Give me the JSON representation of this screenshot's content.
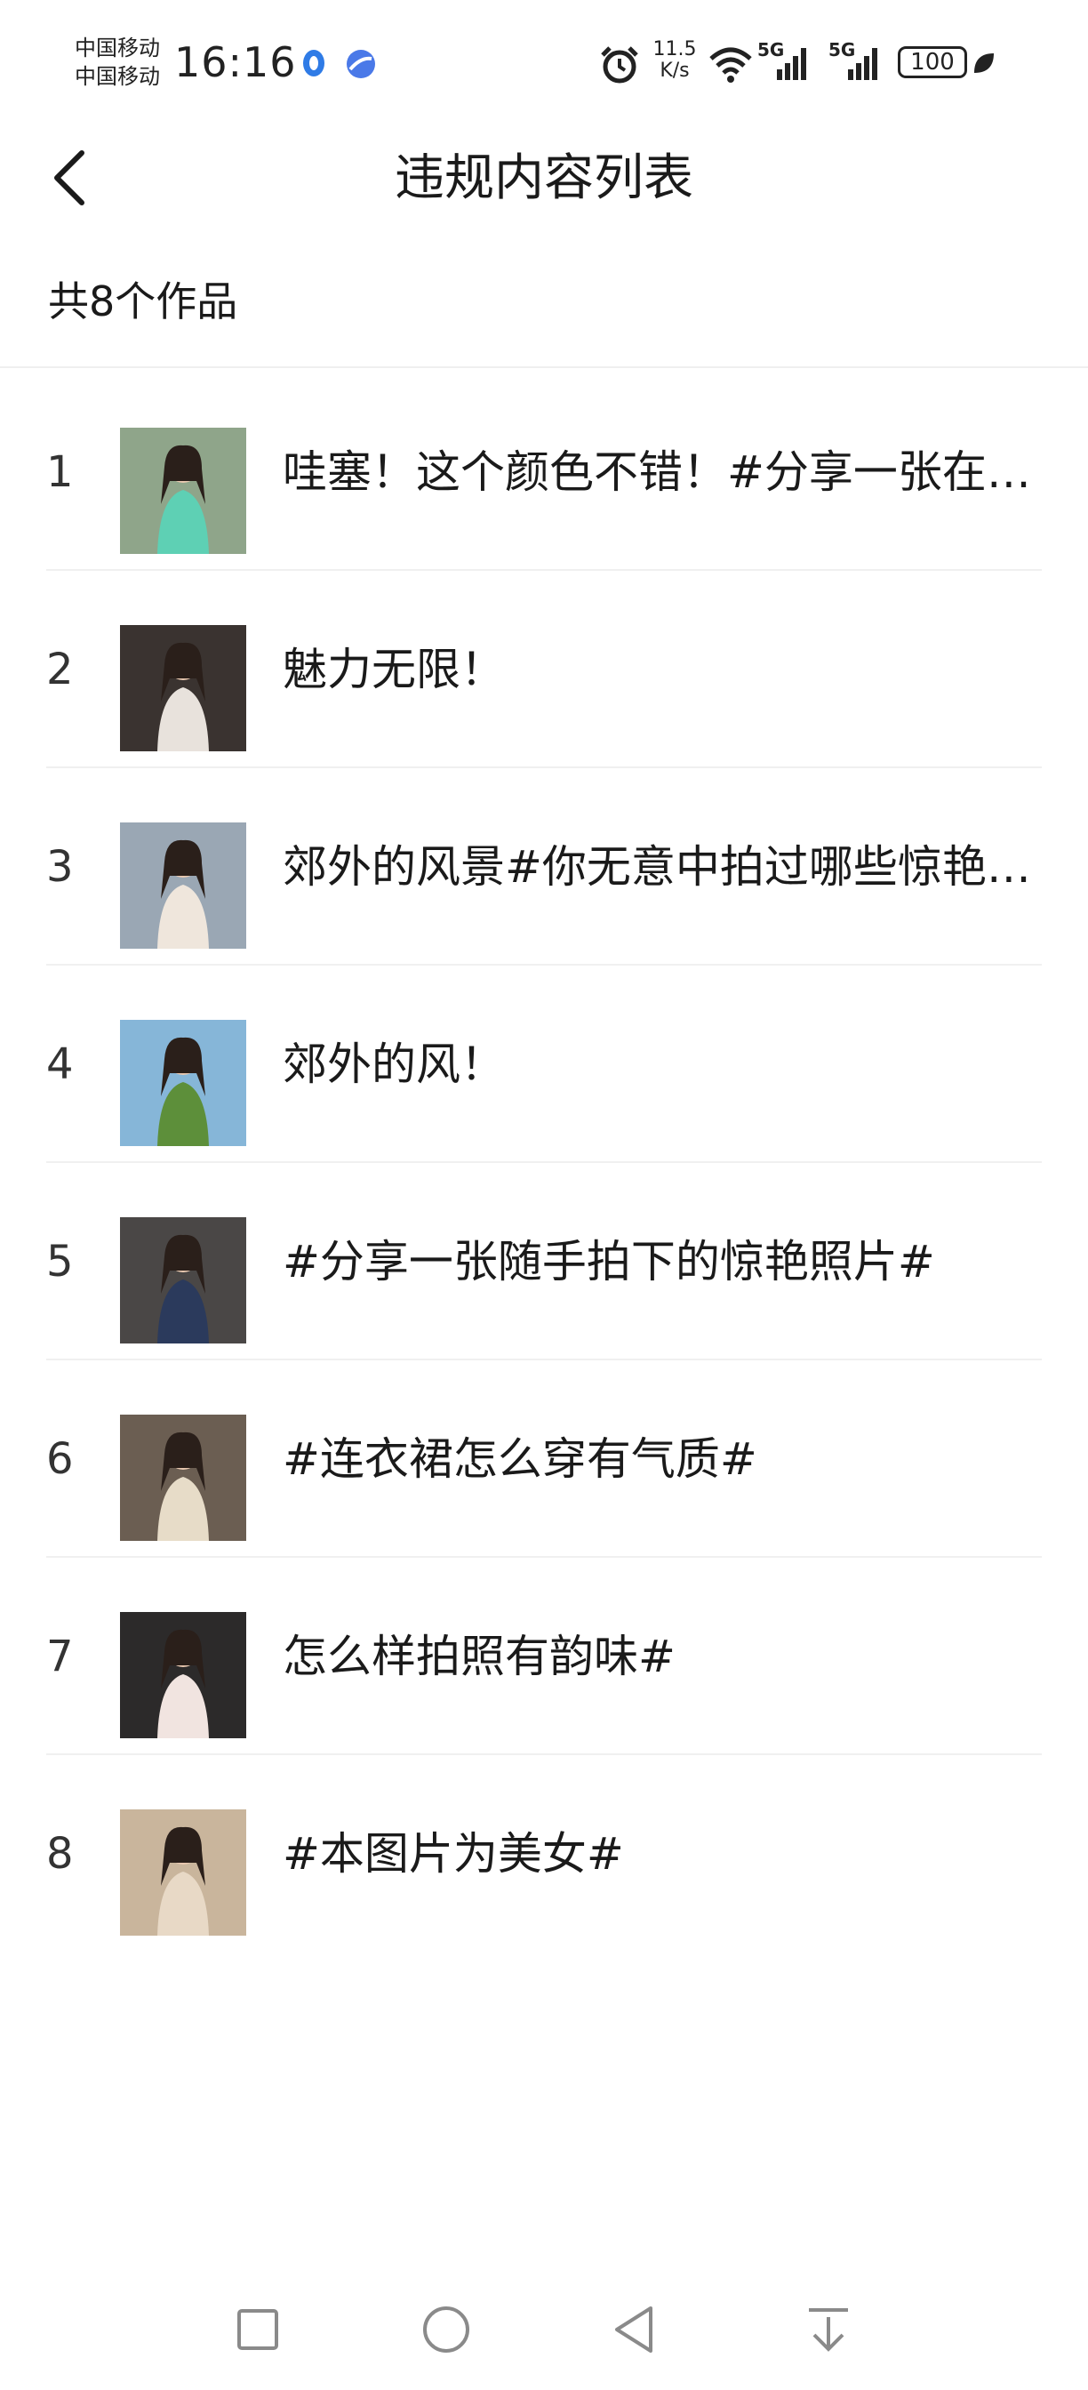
{
  "status_bar": {
    "carrier_1": "中国移动",
    "carrier_2": "中国移动",
    "time": "16:16",
    "net_speed_value": "11.5",
    "net_speed_unit": "K/s",
    "sim1_network": "5G",
    "sim2_network": "5G",
    "battery": "100"
  },
  "header": {
    "title": "违规内容列表"
  },
  "summary": {
    "count_text": "共8个作品"
  },
  "items": [
    {
      "index": "1",
      "title": "哇塞！这个颜色不错！#分享一张在超级热的天气下拍摄的照片#",
      "thumb_bg": "#8fa58a",
      "thumb_accent": "#5ed0b4"
    },
    {
      "index": "2",
      "title": "魅力无限！",
      "thumb_bg": "#3a3330",
      "thumb_accent": "#e8e2dc"
    },
    {
      "index": "3",
      "title": "郊外的风景#你无意中拍过哪些惊艳的照片#",
      "thumb_bg": "#9aa7b4",
      "thumb_accent": "#efe6dc"
    },
    {
      "index": "4",
      "title": "郊外的风！",
      "thumb_bg": "#86b6d8",
      "thumb_accent": "#5d8f3a"
    },
    {
      "index": "5",
      "title": "#分享一张随手拍下的惊艳照片#",
      "thumb_bg": "#4a4746",
      "thumb_accent": "#2b3a5c"
    },
    {
      "index": "6",
      "title": "#连衣裙怎么穿有气质#",
      "thumb_bg": "#6b5e52",
      "thumb_accent": "#e7dcc8"
    },
    {
      "index": "7",
      "title": "怎么样拍照有韵味#",
      "thumb_bg": "#2c2a2a",
      "thumb_accent": "#f1e4e0"
    },
    {
      "index": "8",
      "title": "#本图片为美女#",
      "thumb_bg": "#c9b59c",
      "thumb_accent": "#e8d9c6"
    }
  ],
  "icons": {
    "back": "chevron-left-icon",
    "nav_recent": "square-icon",
    "nav_home": "circle-icon",
    "nav_back": "triangle-left-icon",
    "nav_menu": "arrow-down-bar-icon"
  },
  "colors": {
    "text": "#1a1a1a",
    "divider": "#f0f0f0",
    "icon_gray": "#8a8a8a"
  }
}
